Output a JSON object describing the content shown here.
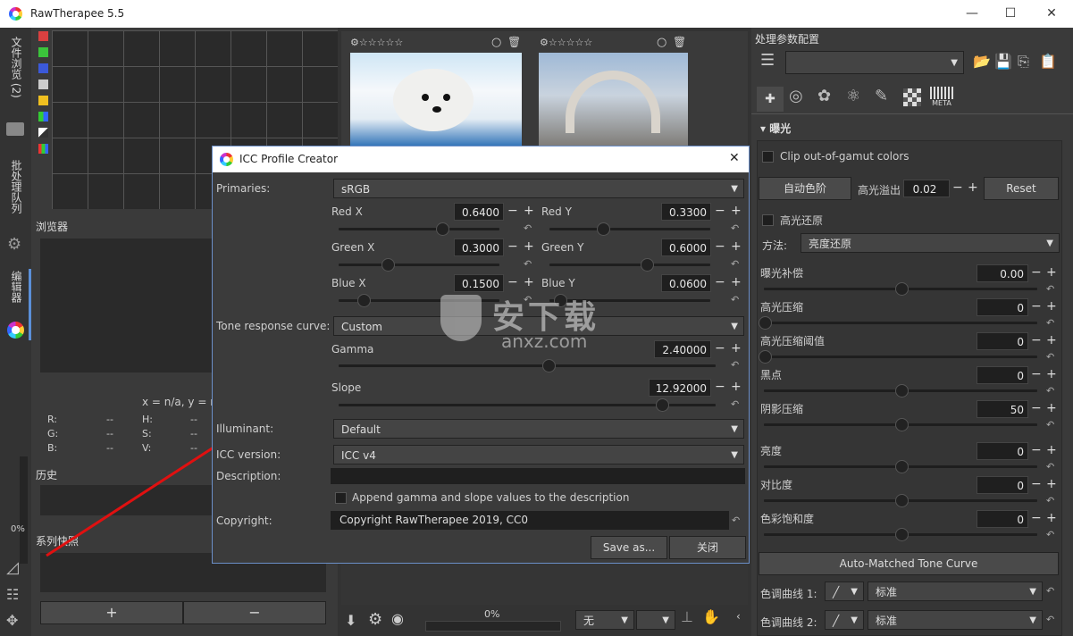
{
  "app": {
    "title": "RawTherapee 5.5",
    "win": {
      "min": "—",
      "max": "☐",
      "close": "✕"
    }
  },
  "lefttabs": {
    "browse": "文件浏览 (2)",
    "queue": "批处理队列",
    "editor": "编辑器",
    "progress": "0%"
  },
  "navigator": {
    "coords": "x = n/a, y = n/a",
    "r_label": "R:",
    "g_label": "G:",
    "b_label": "B:",
    "h_label": "H:",
    "s_label": "S:",
    "v_label": "V:",
    "r": "--",
    "g": "--",
    "b": "--",
    "h": "--",
    "s": "--",
    "v": "--"
  },
  "panels": {
    "browser": "浏览器",
    "history": "历史",
    "snapshots": "系列快照",
    "plus": "+",
    "minus": "−"
  },
  "swatches": [
    "#d94040",
    "#3bc43b",
    "#3b59d9",
    "#cccccc",
    "#f0c020"
  ],
  "thumbs": {
    "stars": "☆☆☆☆☆",
    "circle": "○",
    "trash": "🗑"
  },
  "bottombar": {
    "progress": "0%",
    "zoom": "无"
  },
  "right": {
    "header": "处理参数配置",
    "section": "曝光",
    "clip_label": "Clip out-of-gamut colors",
    "auto_label": "自动色阶",
    "highlight_clip_label": "高光溢出",
    "highlight_clip_value": "0.02",
    "reset_label": "Reset",
    "hl_recovery_label": "高光还原",
    "method_label": "方法:",
    "method_value": "亮度还原",
    "sliders": [
      {
        "label": "曝光补偿",
        "value": "0.00",
        "pos": 0.5
      },
      {
        "label": "高光压缩",
        "value": "0",
        "pos": 0.0
      },
      {
        "label": "高光压缩阈值",
        "value": "0",
        "pos": 0.0
      },
      {
        "label": "黑点",
        "value": "0",
        "pos": 0.5
      },
      {
        "label": "阴影压缩",
        "value": "50",
        "pos": 0.5
      },
      {
        "label": "亮度",
        "value": "0",
        "pos": 0.5
      },
      {
        "label": "对比度",
        "value": "0",
        "pos": 0.5
      },
      {
        "label": "色彩饱和度",
        "value": "0",
        "pos": 0.5
      }
    ],
    "tone_curve_btn": "Auto-Matched Tone Curve",
    "curve1_label": "色调曲线 1:",
    "curve1_value": "标准",
    "curve2_label": "色调曲线 2:",
    "curve2_value": "标准",
    "meta_label": "META"
  },
  "dialog": {
    "title": "ICC Profile Creator",
    "close": "✕",
    "primaries_label": "Primaries:",
    "primaries_value": "sRGB",
    "red_x_label": "Red X",
    "red_x": "0.6400",
    "red_x_pos": 0.64,
    "red_y_label": "Red Y",
    "red_y": "0.3300",
    "red_y_pos": 0.33,
    "green_x_label": "Green X",
    "green_x": "0.3000",
    "green_x_pos": 0.3,
    "green_y_label": "Green Y",
    "green_y": "0.6000",
    "green_y_pos": 0.6,
    "blue_x_label": "Blue X",
    "blue_x": "0.1500",
    "blue_x_pos": 0.15,
    "blue_y_label": "Blue Y",
    "blue_y": "0.0600",
    "blue_y_pos": 0.06,
    "trc_label": "Tone response curve:",
    "trc_value": "Custom",
    "gamma_label": "Gamma",
    "gamma_value": "2.40000",
    "slope_label": "Slope",
    "slope_value": "12.92000",
    "illuminant_label": "Illuminant:",
    "illuminant_value": "Default",
    "icc_version_label": "ICC version:",
    "icc_version_value": "ICC v4",
    "description_label": "Description:",
    "append_label": "Append gamma and slope values to the description",
    "copyright_label": "Copyright:",
    "copyright_value": "Copyright RawTherapee 2019, CC0",
    "save_btn": "Save as...",
    "close_btn": "关闭"
  },
  "watermark": {
    "text": "安下载",
    "sub": "anxz.com"
  }
}
